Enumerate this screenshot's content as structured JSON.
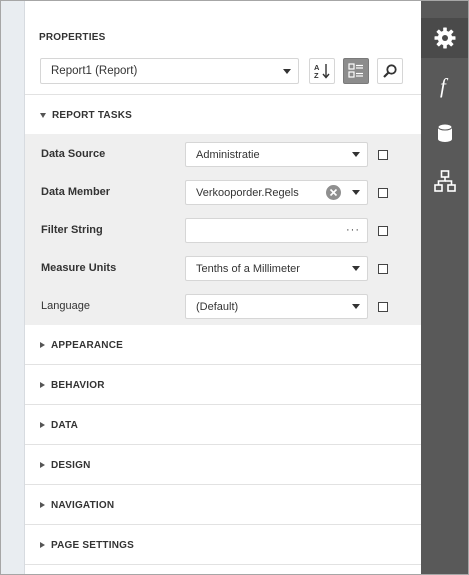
{
  "panel": {
    "title": "PROPERTIES"
  },
  "selector": {
    "value": "Report1 (Report)"
  },
  "toolbar": {
    "sort_icon": "sort-az-icon",
    "categories_icon": "categories-icon",
    "search_icon": "search-icon"
  },
  "tasks": {
    "label": "REPORT TASKS",
    "rows": [
      {
        "label": "Data Source",
        "value": "Administratie",
        "editor": "dropdown"
      },
      {
        "label": "Data Member",
        "value": "Verkooporder.Regels",
        "editor": "dropdown-clear"
      },
      {
        "label": "Filter String",
        "value": "",
        "editor": "ellipsis",
        "button": "···"
      },
      {
        "label": "Measure Units",
        "value": "Tenths of a Millimeter",
        "editor": "dropdown"
      },
      {
        "label": "Language",
        "value": "(Default)",
        "editor": "dropdown"
      }
    ]
  },
  "sections": [
    {
      "label": "APPEARANCE"
    },
    {
      "label": "BEHAVIOR"
    },
    {
      "label": "DATA"
    },
    {
      "label": "DESIGN"
    },
    {
      "label": "NAVIGATION"
    },
    {
      "label": "PAGE SETTINGS"
    }
  ],
  "rightbar": {
    "items": [
      {
        "icon": "gear-icon",
        "active": true
      },
      {
        "icon": "function-icon",
        "active": false
      },
      {
        "icon": "database-icon",
        "active": false
      },
      {
        "icon": "hierarchy-icon",
        "active": false
      }
    ]
  }
}
